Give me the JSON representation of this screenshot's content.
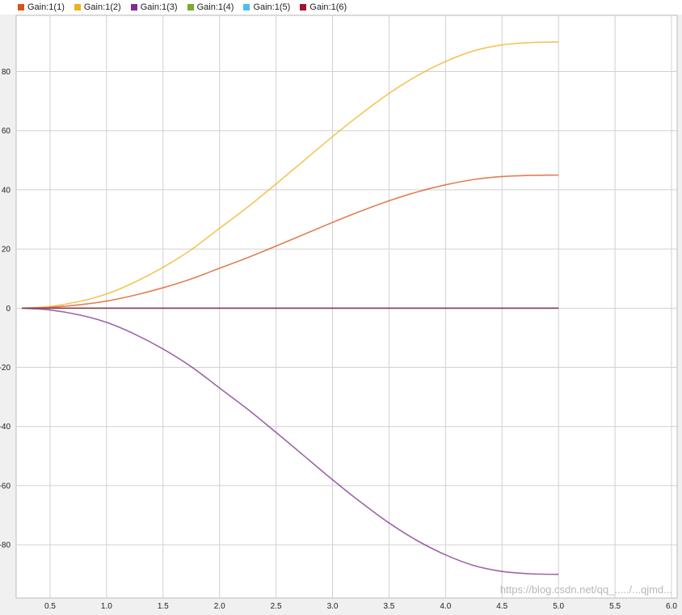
{
  "chart_data": {
    "type": "line",
    "title": "",
    "xlabel": "",
    "ylabel": "",
    "xlim": [
      0.2,
      6.05
    ],
    "ylim": [
      -98,
      99
    ],
    "x_ticks": [
      0.5,
      1.0,
      1.5,
      2.0,
      2.5,
      3.0,
      3.5,
      4.0,
      4.5,
      5.0,
      5.5,
      6.0
    ],
    "x_tick_labels": [
      "0.5",
      "1.0",
      "1.5",
      "2.0",
      "2.5",
      "3.0",
      "3.5",
      "4.0",
      "4.5",
      "5.0",
      "5.5",
      "6.0"
    ],
    "y_ticks": [
      -80,
      -60,
      -40,
      -20,
      0,
      20,
      40,
      60,
      80
    ],
    "y_tick_labels": [
      "-80",
      "-60",
      "-40",
      "-20",
      "0",
      "20",
      "40",
      "60",
      "80"
    ],
    "grid": true,
    "legend_position": "top",
    "x": [
      0.25,
      0.5,
      0.75,
      1.0,
      1.25,
      1.5,
      1.75,
      2.0,
      2.25,
      2.5,
      2.75,
      3.0,
      3.25,
      3.5,
      3.75,
      4.0,
      4.25,
      4.5,
      4.75,
      5.0
    ],
    "series": [
      {
        "name": "Gain:1(1)",
        "color": "#d95319",
        "values": [
          0,
          0.3,
          1.1,
          2.4,
          4.4,
          6.9,
          9.9,
          13.5,
          17.1,
          21.0,
          25.0,
          29.0,
          32.8,
          36.3,
          39.3,
          41.7,
          43.5,
          44.5,
          44.9,
          45.0
        ]
      },
      {
        "name": "Gain:1(2)",
        "color": "#edb120",
        "values": [
          0,
          0.6,
          2.2,
          4.8,
          8.8,
          13.8,
          19.8,
          27.0,
          34.2,
          42.0,
          50.0,
          58.0,
          65.6,
          72.6,
          78.6,
          83.4,
          87.0,
          89.0,
          89.8,
          90.0
        ]
      },
      {
        "name": "Gain:1(3)",
        "color": "#7e2f8e",
        "values": [
          0,
          -0.6,
          -2.2,
          -4.8,
          -8.8,
          -13.8,
          -19.8,
          -27.0,
          -34.2,
          -42.0,
          -50.0,
          -58.0,
          -65.6,
          -72.6,
          -78.6,
          -83.4,
          -87.0,
          -89.0,
          -89.8,
          -90.0
        ]
      },
      {
        "name": "Gain:1(4)",
        "color": "#77ac30",
        "values": [
          0,
          0,
          0,
          0,
          0,
          0,
          0,
          0,
          0,
          0,
          0,
          0,
          0,
          0,
          0,
          0,
          0,
          0,
          0,
          0
        ]
      },
      {
        "name": "Gain:1(5)",
        "color": "#4dbeee",
        "values": [
          0,
          0,
          0,
          0,
          0,
          0,
          0,
          0,
          0,
          0,
          0,
          0,
          0,
          0,
          0,
          0,
          0,
          0,
          0,
          0
        ]
      },
      {
        "name": "Gain:1(6)",
        "color": "#a2142f",
        "values": [
          0,
          0,
          0,
          0,
          0,
          0,
          0,
          0,
          0,
          0,
          0,
          0,
          0,
          0,
          0,
          0,
          0,
          0,
          0,
          0
        ]
      }
    ]
  },
  "watermark": "https://blog.csdn.net/qq_...../...qjmd..."
}
